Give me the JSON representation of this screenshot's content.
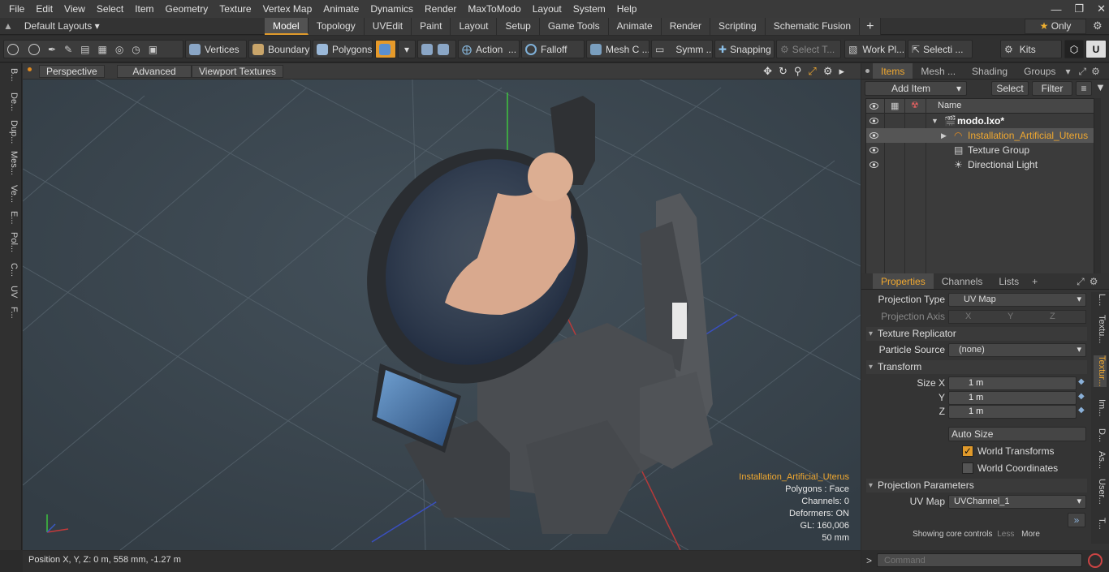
{
  "menu": [
    "File",
    "Edit",
    "View",
    "Select",
    "Item",
    "Geometry",
    "Texture",
    "Vertex Map",
    "Animate",
    "Dynamics",
    "Render",
    "MaxToModo",
    "Layout",
    "System",
    "Help"
  ],
  "window_controls": [
    "—",
    "❐",
    "✕"
  ],
  "layout_menu": "Default Layouts",
  "tabs": [
    "Model",
    "Topology",
    "UVEdit",
    "Paint",
    "Layout",
    "Setup",
    "Game Tools",
    "Animate",
    "Render",
    "Scripting",
    "Schematic Fusion"
  ],
  "active_tab": "Model",
  "only_label": "Only",
  "toolbar": {
    "vertices": "Vertices",
    "boundary": "Boundary",
    "polygons": "Polygons",
    "action": "Action",
    "falloff": "Falloff",
    "mesh": "Mesh C ...",
    "symm": "Symm ...",
    "snapping": "Snapping",
    "select_t": "Select T...",
    "work_pl": "Work Pl...",
    "selecti": "Selecti ...",
    "kits": "Kits"
  },
  "left_tabs": [
    "B...",
    "De...",
    "Dup...",
    "Mes...",
    "Ve...",
    "E...",
    "Pol...",
    "C...",
    "UV",
    "F..."
  ],
  "viewport": {
    "perspective": "Perspective",
    "advanced": "Advanced",
    "textures": "Viewport Textures",
    "stats": {
      "selected": "Installation_Artificial_Uterus",
      "polygons": "Polygons : Face",
      "channels": "Channels: 0",
      "deformers": "Deformers: ON",
      "gl": "GL: 160,006",
      "scale": "50 mm"
    }
  },
  "status": "Position X, Y, Z:   0 m, 558 mm, -1.27 m",
  "items_panel": {
    "tabs": [
      "Items",
      "Mesh ...",
      "Shading",
      "Groups"
    ],
    "add_item": "Add Item",
    "select": "Select",
    "filter": "Filter",
    "name_col": "Name",
    "rows": [
      {
        "label": "modo.lxo*"
      },
      {
        "label": "Installation_Artificial_Uterus"
      },
      {
        "label": "Texture Group"
      },
      {
        "label": "Directional Light"
      }
    ]
  },
  "props_panel": {
    "tabs": [
      "Properties",
      "Channels",
      "Lists"
    ],
    "projection_type_label": "Projection Type",
    "projection_type_value": "UV Map",
    "projection_axis_label": "Projection Axis",
    "axis_x": "X",
    "axis_y": "Y",
    "axis_z": "Z",
    "texture_replicator": "Texture Replicator",
    "particle_source_label": "Particle Source",
    "particle_source_value": "(none)",
    "transform": "Transform",
    "size_x_label": "Size X",
    "y_label": "Y",
    "z_label": "Z",
    "size_x": "1 m",
    "size_y": "1 m",
    "size_z": "1 m",
    "auto_size": "Auto Size",
    "world_transforms": "World Transforms",
    "world_coordinates": "World Coordinates",
    "projection_params": "Projection Parameters",
    "uv_map_label": "UV Map",
    "uv_map_value": "UVChannel_1",
    "showing": "Showing core controls",
    "less": "Less",
    "more": "More",
    "command_placeholder": "Command"
  },
  "right_tabs": [
    "L...",
    "Textu...",
    "Textur...",
    "Im...",
    "D...",
    "As...",
    "User...",
    "T..."
  ]
}
